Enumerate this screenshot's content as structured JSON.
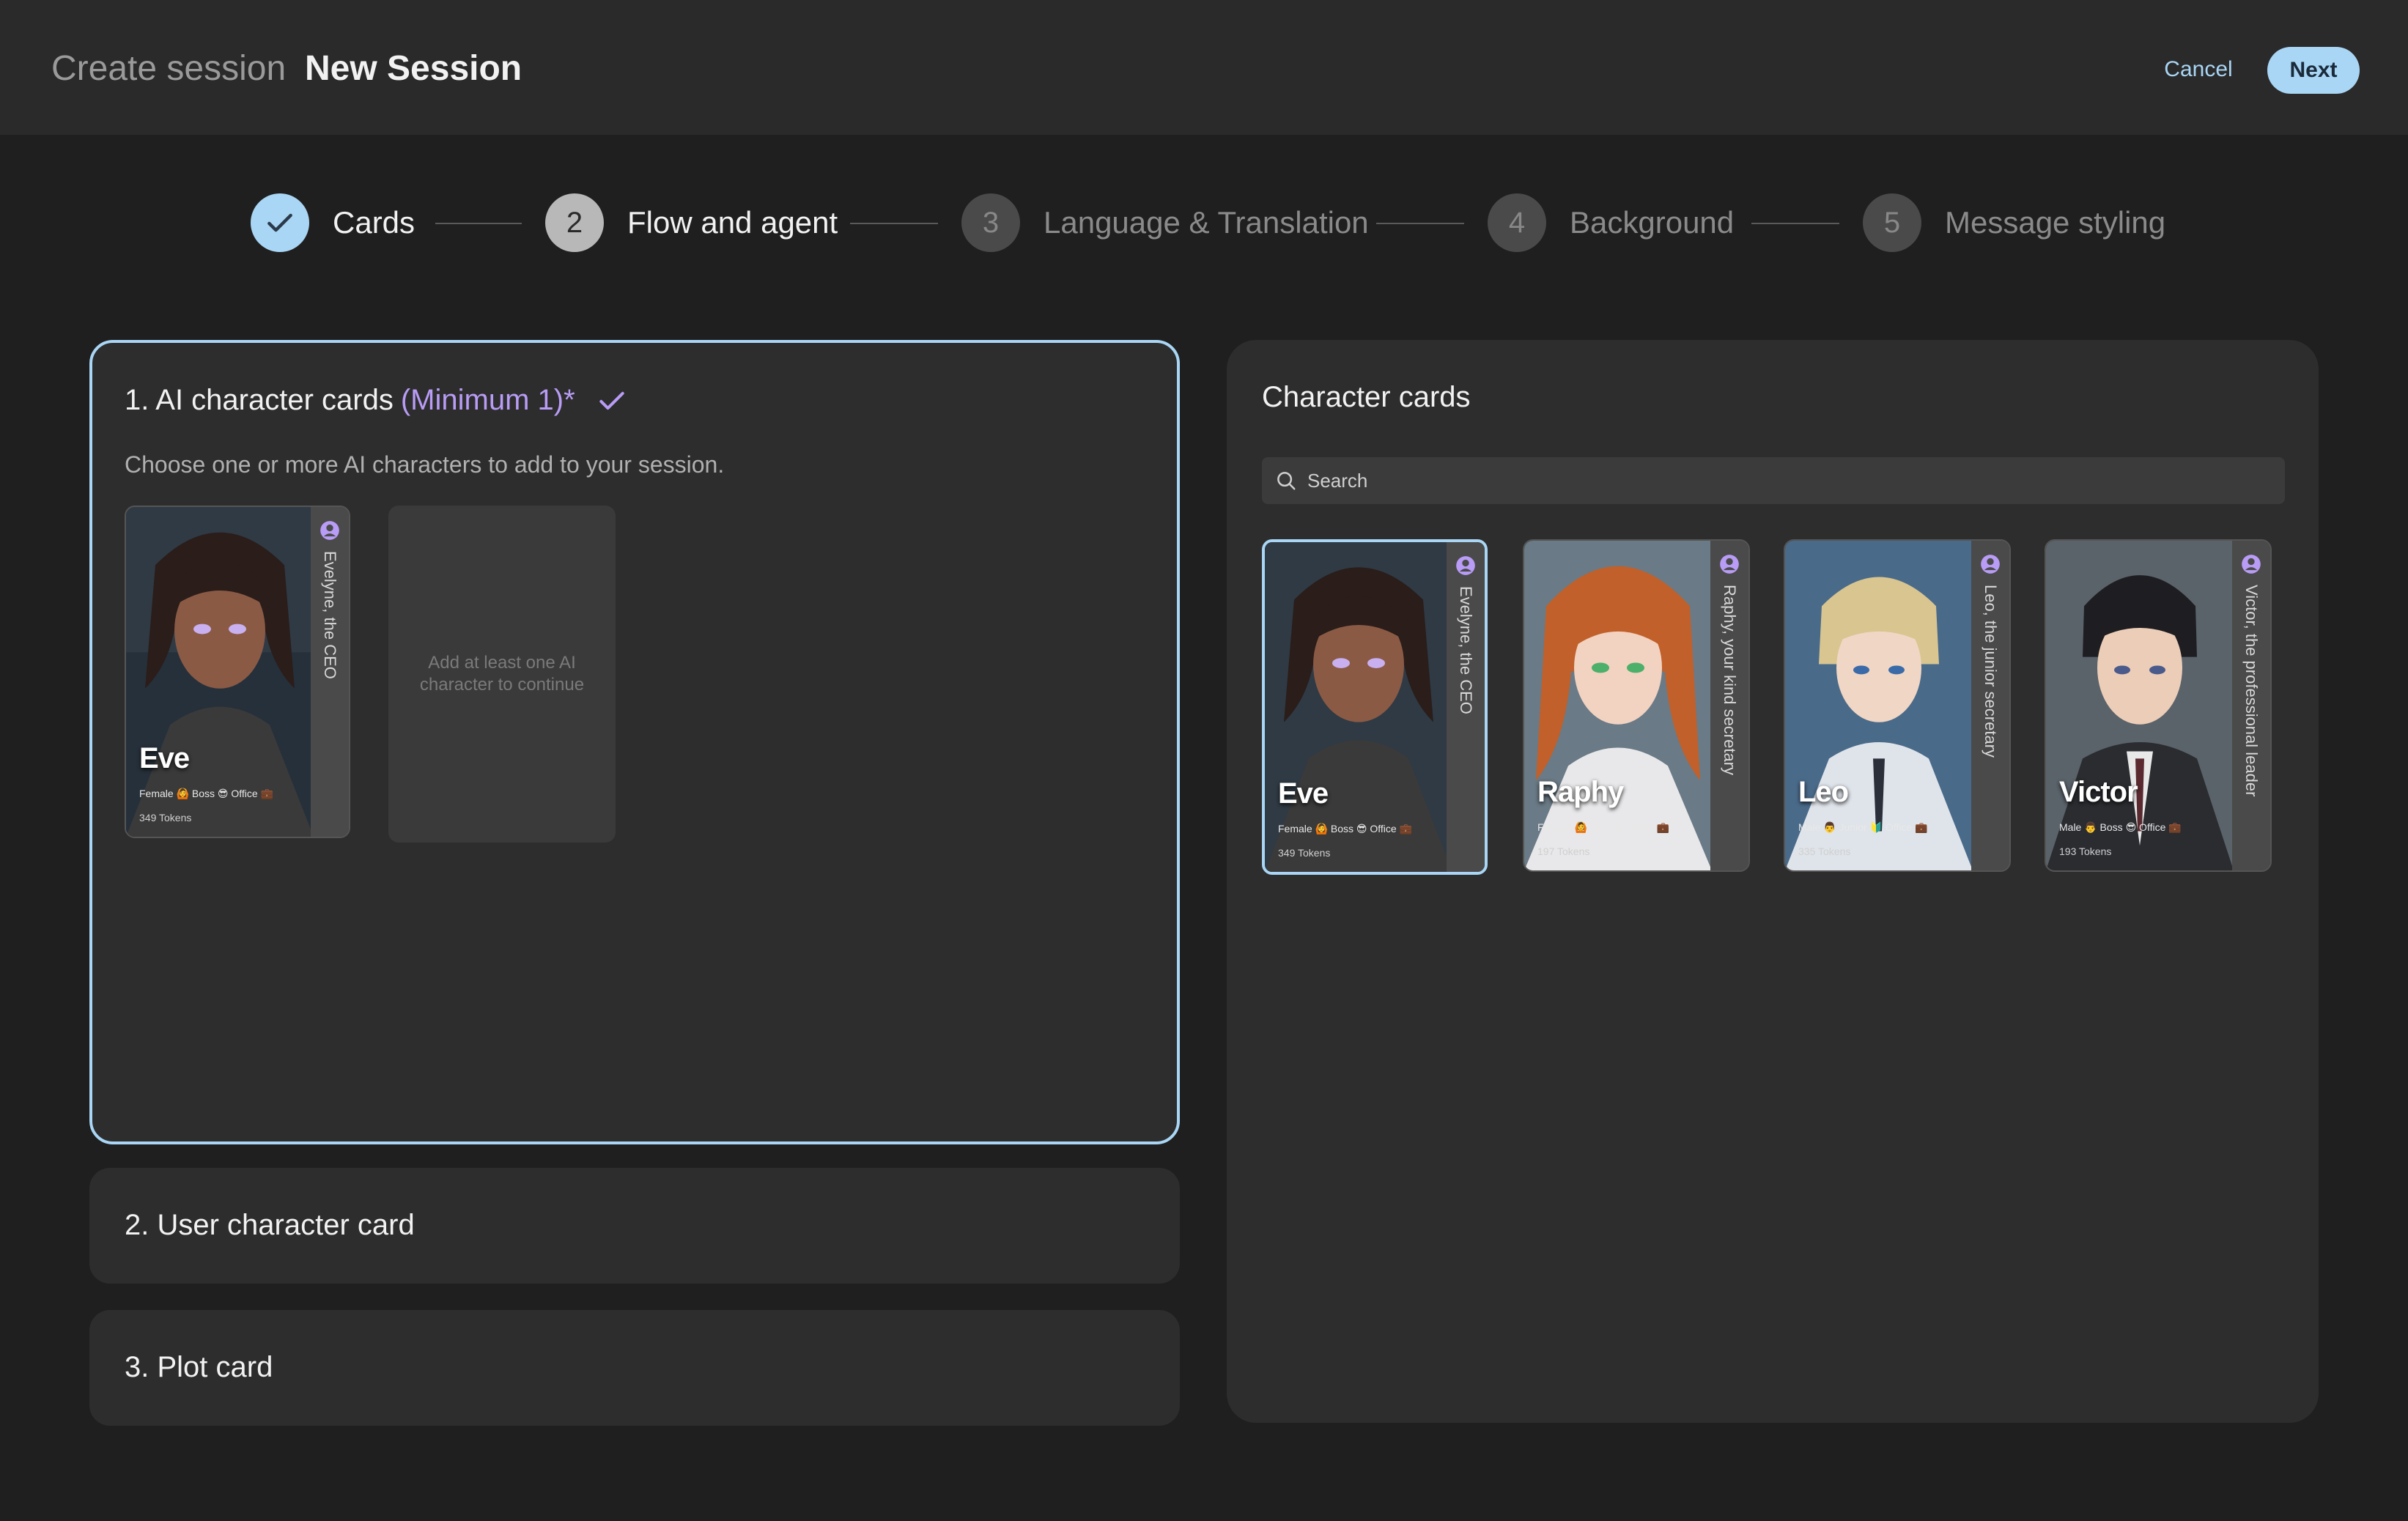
{
  "header": {
    "breadcrumb": "Create session",
    "title": "New Session",
    "cancel_label": "Cancel",
    "next_label": "Next"
  },
  "stepper": {
    "steps": [
      {
        "number": "1",
        "label": "Cards",
        "state": "done"
      },
      {
        "number": "2",
        "label": "Flow and agent",
        "state": "active"
      },
      {
        "number": "3",
        "label": "Language & Translation",
        "state": "pending"
      },
      {
        "number": "4",
        "label": "Background",
        "state": "pending"
      },
      {
        "number": "5",
        "label": "Message styling",
        "state": "pending"
      }
    ]
  },
  "ai_cards": {
    "title": "1. AI character cards",
    "minimum": "(Minimum 1)*",
    "description": "Choose one or more AI characters to add to your session.",
    "placeholder": "Add at least one AI character to continue",
    "selected": [
      {
        "name": "Eve",
        "subtitle": "Evelyne, the CEO",
        "tags": "Female 🙆 Boss 😎 Office 💼",
        "tokens": "349 Tokens"
      }
    ]
  },
  "user_card": {
    "title": "2. User character card"
  },
  "plot_card": {
    "title": "3. Plot card"
  },
  "library": {
    "title": "Character cards",
    "search_placeholder": "Search",
    "cards": [
      {
        "name": "Eve",
        "subtitle": "Evelyne, the CEO",
        "tags": "Female 🙆 Boss 😎 Office 💼",
        "tokens": "349 Tokens",
        "selected": true
      },
      {
        "name": "Raphy",
        "subtitle": "Raphy, your kind secretary",
        "tags": "Female 🙆 Kind 😊 Office 💼",
        "tokens": "197 Tokens",
        "selected": false
      },
      {
        "name": "Leo",
        "subtitle": "Leo, the junior secretary",
        "tags": "Male 👨 Junior 🔰 Office 💼",
        "tokens": "335 Tokens",
        "selected": false
      },
      {
        "name": "Victor",
        "subtitle": "Victor, the professional leader",
        "tags": "Male 👨 Boss 😎 Office 💼",
        "tokens": "193 Tokens",
        "selected": false
      }
    ]
  },
  "colors": {
    "accent": "#a9d6f5",
    "highlight_purple": "#b89cf5",
    "background": "#1f1f1f",
    "panel": "#2d2d2d"
  }
}
